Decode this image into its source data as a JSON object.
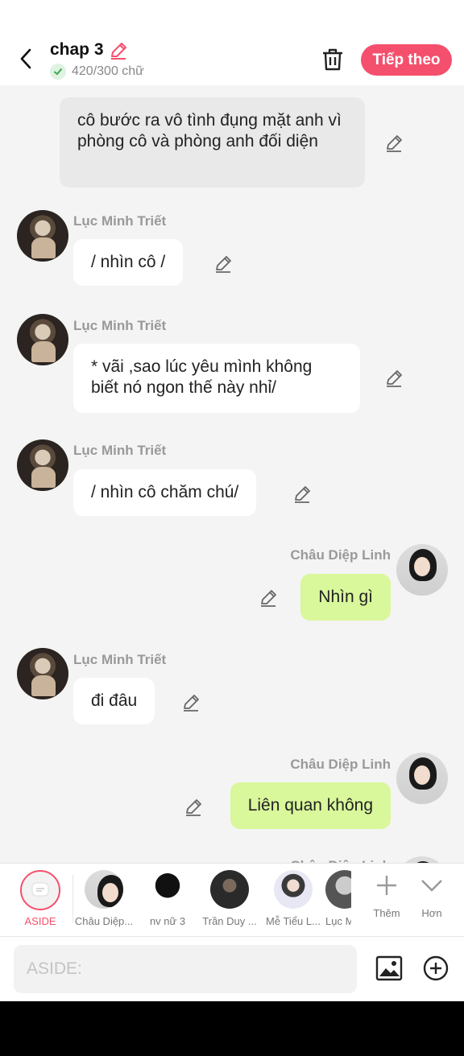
{
  "header": {
    "title": "chap 3",
    "word_count": "420/300 chữ",
    "next_label": "Tiếp theo"
  },
  "messages": {
    "narr1": "cô bước ra vô tình đụng mặt anh vì phòng cô và phòng anh đối diện",
    "m1_name": "Lục Minh Triết",
    "m1_text": "/ nhìn cô /",
    "m2_name": "Lục Minh Triết",
    "m2_text": "* vãi ,sao lúc yêu mình không biết nó ngon thế này nhỉ/",
    "m3_name": "Lục Minh Triết",
    "m3_text": "/ nhìn cô chăm chú/",
    "m4_name": "Châu Diệp Linh",
    "m4_text": "Nhìn gì",
    "m5_name": "Lục Minh Triết",
    "m5_text": "đi đâu",
    "m6_name": "Châu Diệp Linh",
    "m6_text": "Liên quan không",
    "m7_name": "Châu Diệp Linh"
  },
  "char_bar": {
    "aside_label": "ASIDE",
    "characters": [
      "Châu Diệp...",
      "nv nữ 3",
      "Trần Duy ...",
      "Mễ Tiểu L...",
      "Lục M"
    ],
    "more_label": "Thêm",
    "collapse_label": "Hơn"
  },
  "input": {
    "placeholder": "ASIDE:"
  },
  "colors": {
    "accent": "#f4506d",
    "right_bubble": "#d9f79b",
    "narration_bubble": "#e9e9e9",
    "background": "#f4f4f4"
  }
}
